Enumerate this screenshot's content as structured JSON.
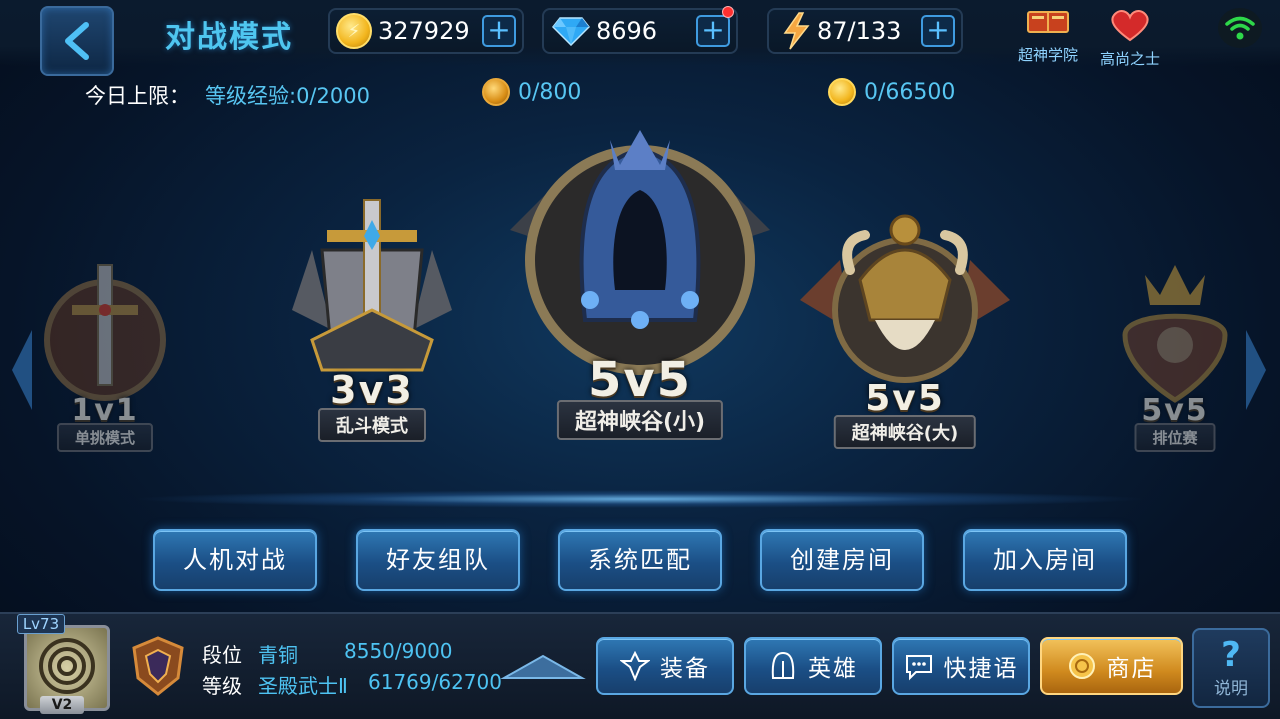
{
  "header": {
    "title": "对战模式",
    "gold": "327929",
    "diamond": "8696",
    "energy": "87/133",
    "academy_label": "超神学院",
    "noble_label": "高尚之士"
  },
  "limits": {
    "label": "今日上限：",
    "exp": "等级经验:0/2000",
    "honor": "0/800",
    "gold": "0/66500"
  },
  "modes": [
    {
      "big": "1v1",
      "sub": "单挑模式"
    },
    {
      "big": "3v3",
      "sub": "乱斗模式"
    },
    {
      "big": "5v5",
      "sub": "超神峡谷(小)"
    },
    {
      "big": "5v5",
      "sub": "超神峡谷(大)"
    },
    {
      "big": "5v5",
      "sub": "排位赛"
    }
  ],
  "actions": {
    "ai": "人机对战",
    "friends": "好友组队",
    "match": "系统匹配",
    "create": "创建房间",
    "join": "加入房间"
  },
  "player": {
    "level": "Lv73",
    "vip": "V2",
    "rank_key": "段位",
    "rank_val": "青铜",
    "rank_points": "8550/9000",
    "grade_key": "等级",
    "grade_val": "圣殿武士Ⅱ",
    "grade_points": "61769/62700"
  },
  "menu": {
    "equip": "装备",
    "hero": "英雄",
    "chat": "快捷语",
    "shop": "商店",
    "help": "说明"
  },
  "colors": {
    "accent": "#4fc6f0",
    "button": "#1b4f86",
    "shop": "#d08a1e"
  }
}
